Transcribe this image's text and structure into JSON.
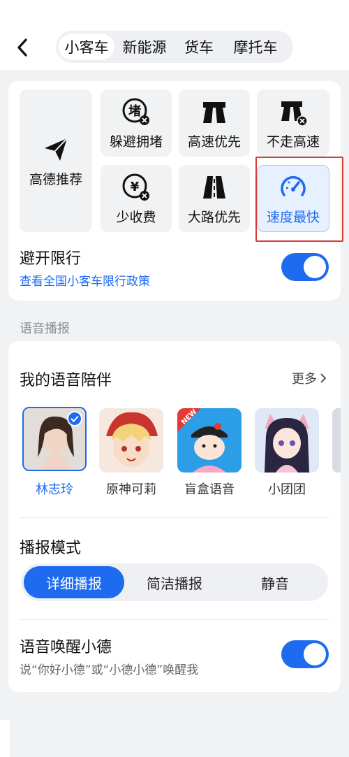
{
  "header": {
    "back_icon": "chevron-left-icon",
    "tabs": [
      {
        "label": "小客车",
        "active": true
      },
      {
        "label": "新能源",
        "active": false
      },
      {
        "label": "货车",
        "active": false
      },
      {
        "label": "摩托车",
        "active": false
      }
    ]
  },
  "route_options": {
    "primary": {
      "label": "高德推荐",
      "icon": "paper-plane-icon"
    },
    "options": [
      {
        "label": "躲避拥堵",
        "icon": "avoid-congestion-icon",
        "selected": false
      },
      {
        "label": "高速优先",
        "icon": "highway-icon",
        "selected": false
      },
      {
        "label": "不走高速",
        "icon": "no-highway-icon",
        "selected": false
      },
      {
        "label": "少收费",
        "icon": "less-toll-icon",
        "selected": false
      },
      {
        "label": "大路优先",
        "icon": "main-road-icon",
        "selected": false
      },
      {
        "label": "速度最快",
        "icon": "speedometer-icon",
        "selected": true
      }
    ],
    "restriction": {
      "title": "避开限行",
      "link": "查看全国小客车限行政策",
      "enabled": true
    }
  },
  "voice": {
    "section_label": "语音播报",
    "companion_title": "我的语音陪伴",
    "more_label": "更多",
    "voices": [
      {
        "name": "林志玲",
        "selected": true
      },
      {
        "name": "原神可莉",
        "selected": false
      },
      {
        "name": "盲盒语音",
        "selected": false,
        "badge": "NEW"
      },
      {
        "name": "小团团",
        "selected": false
      }
    ],
    "mode_title": "播报模式",
    "modes": [
      {
        "label": "详细播报",
        "active": true
      },
      {
        "label": "简洁播报",
        "active": false
      },
      {
        "label": "静音",
        "active": false
      }
    ],
    "wake": {
      "title": "语音唤醒小德",
      "subtitle": "说“你好小德”或“小德小德”唤醒我",
      "enabled": true
    }
  },
  "colors": {
    "accent": "#1e6bf0",
    "highlight_box": "#d93a3a",
    "background": "#f1f2f4"
  }
}
